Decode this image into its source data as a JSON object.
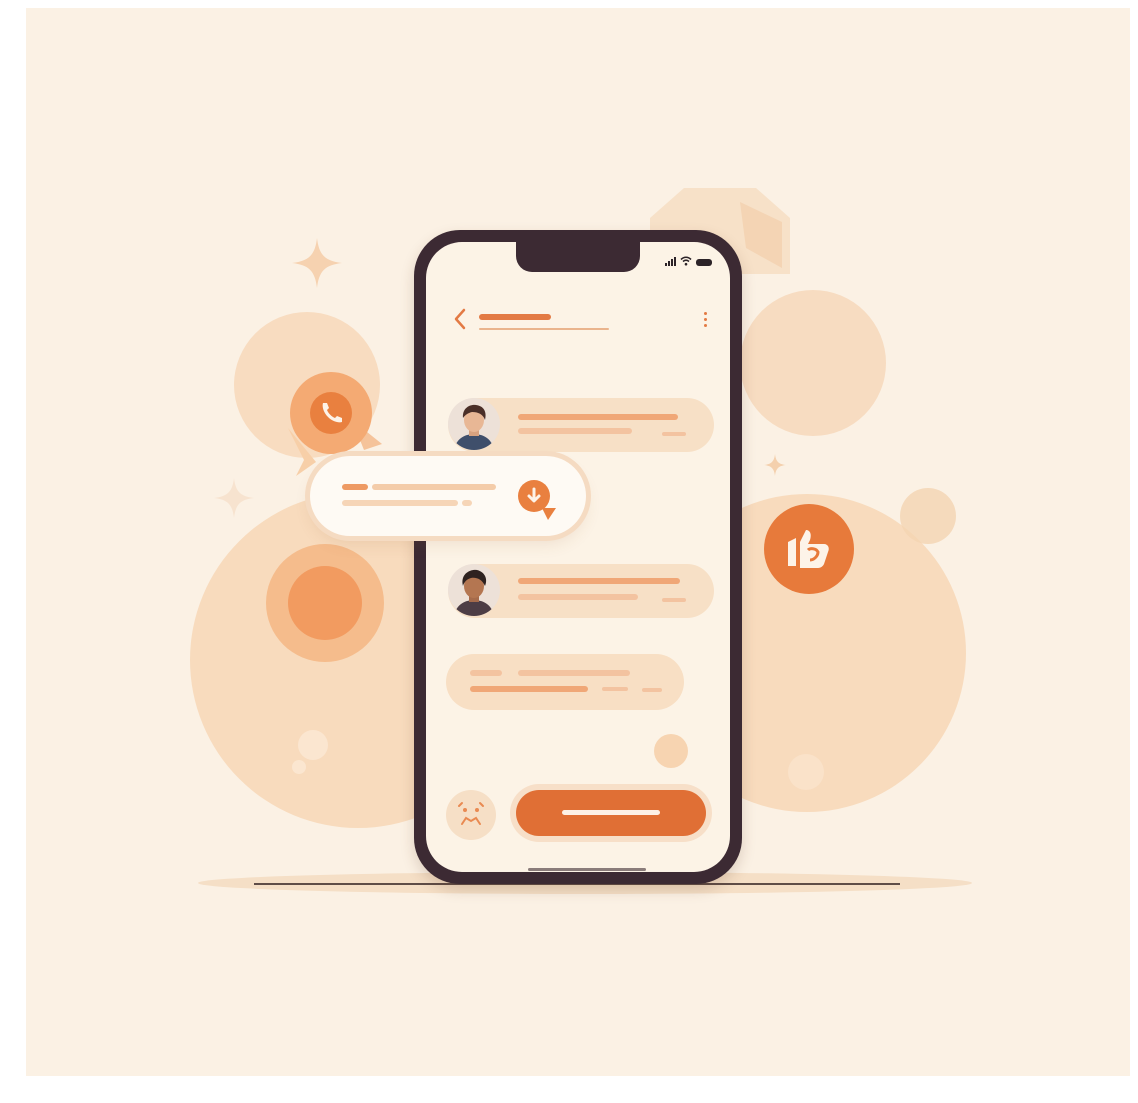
{
  "colors": {
    "background": "#fbf1e4",
    "accent": "#e06f35",
    "accent_light": "#f0a777",
    "phone_frame": "#3c2a33",
    "screen": "#fcf3e6",
    "bubble": "#f8e2cb"
  },
  "icons": {
    "back": "chevron-left-icon",
    "menu": "kebab-menu-icon",
    "signal": "signal-icon",
    "wifi": "wifi-icon",
    "battery": "battery-icon",
    "call": "phone-call-icon",
    "download": "download-icon",
    "like": "thumbs-up-icon",
    "emoji": "emoji-icon",
    "sparkle": "sparkle-icon"
  }
}
